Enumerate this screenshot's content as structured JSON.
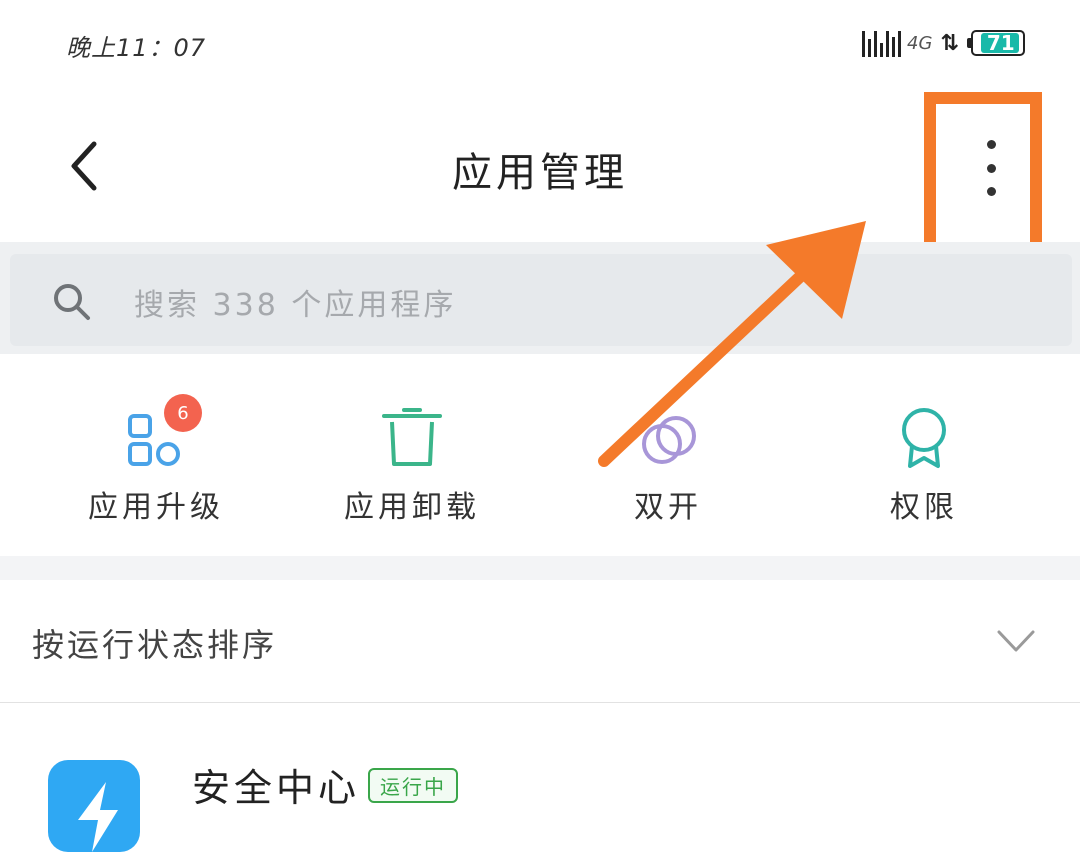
{
  "status_bar": {
    "time": "晚上11：07",
    "network": "4G",
    "battery": "71",
    "battery_color": "#19b9a9"
  },
  "header": {
    "title": "应用管理",
    "back_icon": "chevron-left-icon",
    "more_icon": "more-vertical-icon",
    "highlight_color": "#f47a2a"
  },
  "search": {
    "placeholder": "搜索 338 个应用程序"
  },
  "quick_actions": [
    {
      "label": "应用升级",
      "icon": "apps-grid-icon",
      "badge": "6"
    },
    {
      "label": "应用卸载",
      "icon": "trash-icon"
    },
    {
      "label": "双开",
      "icon": "dual-app-icon"
    },
    {
      "label": "权限",
      "icon": "badge-ribbon-icon"
    }
  ],
  "sort": {
    "label": "按运行状态排序"
  },
  "apps": [
    {
      "name": "安全中心",
      "status": "运行中"
    }
  ]
}
